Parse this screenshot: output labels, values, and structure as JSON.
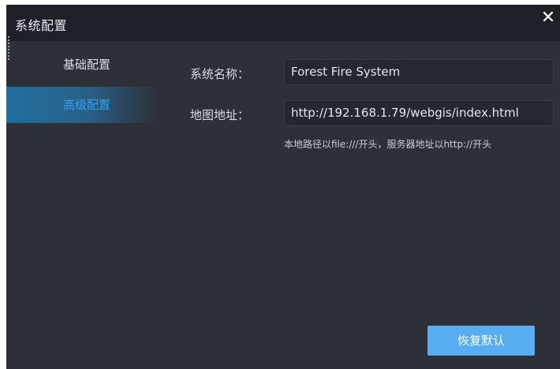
{
  "dialog": {
    "title": "系统配置",
    "close_icon": "close-icon"
  },
  "sidebar": {
    "items": [
      {
        "label": "基础配置",
        "active": false
      },
      {
        "label": "高级配置",
        "active": true
      }
    ]
  },
  "form": {
    "system_name_label": "系统名称：",
    "system_name_value": "Forest Fire System",
    "map_url_label": "地图地址：",
    "map_url_value": "http://192.168.1.79/webgis/index.html",
    "hint": "本地路径以file:///开头，服务器地址以http://开头"
  },
  "actions": {
    "restore_default_label": "恢复默认"
  },
  "colors": {
    "dialog_bg": "#2e3038",
    "titlebar_bg": "#1f2129",
    "accent": "#2ea3f2",
    "button_bg": "#56aef0"
  }
}
